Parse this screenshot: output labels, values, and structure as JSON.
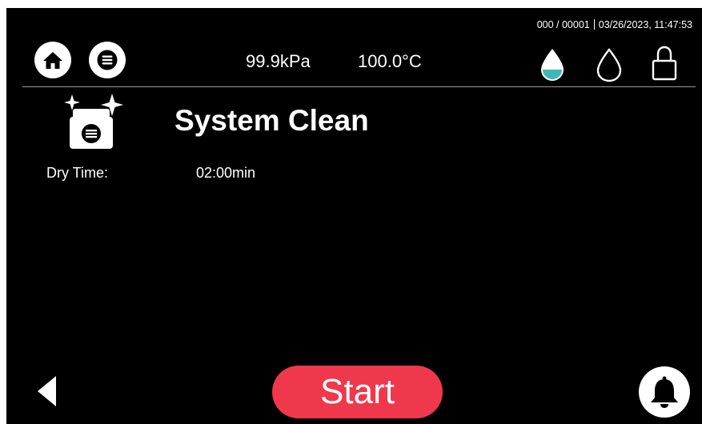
{
  "status": {
    "counter": "000 / 00001",
    "datetime": "03/26/2023, 11:47:53"
  },
  "header": {
    "pressure": "99.9kPa",
    "temperature": "100.0°C",
    "icons": [
      "home-icon",
      "menu-icon",
      "water-level-icon",
      "water-drop-icon",
      "lock-icon"
    ]
  },
  "main": {
    "title": "System Clean",
    "icon": "system-clean-icon",
    "dry_time_label": "Dry Time:",
    "dry_time_value": "02:00min"
  },
  "footer": {
    "start_label": "Start",
    "icons": [
      "back-arrow-icon",
      "bell-icon"
    ]
  },
  "colors": {
    "background": "#000000",
    "start_button": "#f0384c",
    "water_level": "#3fb8b8"
  }
}
